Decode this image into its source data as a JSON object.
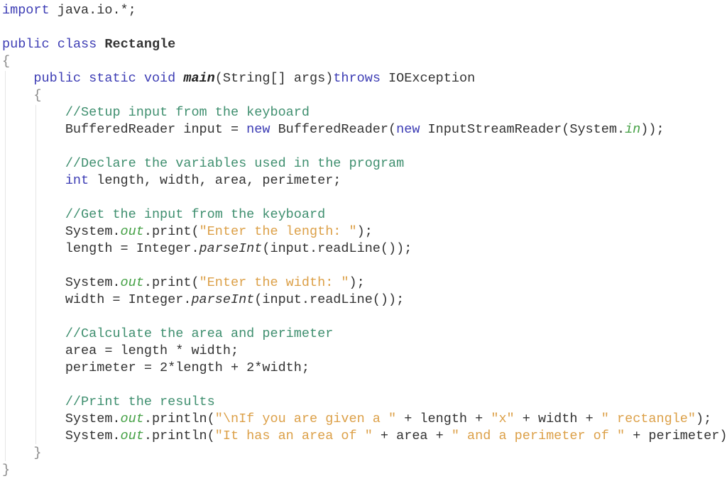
{
  "editor": {
    "language": "java",
    "colors": {
      "keyword": "#3c3cb4",
      "comment": "#3f8f6f",
      "string": "#dca048",
      "static_field": "#44a044",
      "text": "#333333"
    },
    "lines": [
      {
        "tokens": [
          {
            "t": "import",
            "k": "kw"
          },
          {
            "t": " java.io.*;",
            "k": "pl"
          }
        ]
      },
      {
        "tokens": []
      },
      {
        "tokens": [
          {
            "t": "public",
            "k": "kw"
          },
          {
            "t": " ",
            "k": "pl"
          },
          {
            "t": "class",
            "k": "kw"
          },
          {
            "t": " ",
            "k": "pl"
          },
          {
            "t": "Rectangle",
            "k": "cls"
          }
        ]
      },
      {
        "tokens": [
          {
            "t": "{",
            "k": "brace"
          }
        ]
      },
      {
        "tokens": [
          {
            "t": "    ",
            "k": "pl"
          },
          {
            "t": "public static void",
            "k": "kw"
          },
          {
            "t": " ",
            "k": "pl"
          },
          {
            "t": "main",
            "k": "mi"
          },
          {
            "t": "(String[] args)",
            "k": "pl"
          },
          {
            "t": "throws",
            "k": "kw"
          },
          {
            "t": " IOException",
            "k": "pl"
          }
        ]
      },
      {
        "tokens": [
          {
            "t": "    ",
            "k": "pl"
          },
          {
            "t": "{",
            "k": "brace"
          }
        ]
      },
      {
        "tokens": [
          {
            "t": "        ",
            "k": "pl"
          },
          {
            "t": "//Setup input from the keyboard",
            "k": "cm"
          }
        ]
      },
      {
        "tokens": [
          {
            "t": "        BufferedReader input = ",
            "k": "pl"
          },
          {
            "t": "new",
            "k": "kw"
          },
          {
            "t": " BufferedReader(",
            "k": "pl"
          },
          {
            "t": "new",
            "k": "kw"
          },
          {
            "t": " InputStreamReader(System.",
            "k": "pl"
          },
          {
            "t": "in",
            "k": "fld"
          },
          {
            "t": "));",
            "k": "pl"
          }
        ]
      },
      {
        "tokens": []
      },
      {
        "tokens": [
          {
            "t": "        ",
            "k": "pl"
          },
          {
            "t": "//Declare the variables used in the program",
            "k": "cm"
          }
        ]
      },
      {
        "tokens": [
          {
            "t": "        ",
            "k": "pl"
          },
          {
            "t": "int",
            "k": "kw"
          },
          {
            "t": " length, width, area, perimeter;",
            "k": "pl"
          }
        ]
      },
      {
        "tokens": []
      },
      {
        "tokens": [
          {
            "t": "        ",
            "k": "pl"
          },
          {
            "t": "//Get the input from the keyboard",
            "k": "cm"
          }
        ]
      },
      {
        "tokens": [
          {
            "t": "        System.",
            "k": "pl"
          },
          {
            "t": "out",
            "k": "fld"
          },
          {
            "t": ".print(",
            "k": "pl"
          },
          {
            "t": "\"Enter the length: \"",
            "k": "str"
          },
          {
            "t": ");",
            "k": "pl"
          }
        ]
      },
      {
        "tokens": [
          {
            "t": "        length = Integer.",
            "k": "pl"
          },
          {
            "t": "parseInt",
            "k": "it"
          },
          {
            "t": "(input.readLine());",
            "k": "pl"
          }
        ]
      },
      {
        "tokens": []
      },
      {
        "tokens": [
          {
            "t": "        System.",
            "k": "pl"
          },
          {
            "t": "out",
            "k": "fld"
          },
          {
            "t": ".print(",
            "k": "pl"
          },
          {
            "t": "\"Enter the width: \"",
            "k": "str"
          },
          {
            "t": ");",
            "k": "pl"
          }
        ]
      },
      {
        "tokens": [
          {
            "t": "        width = Integer.",
            "k": "pl"
          },
          {
            "t": "parseInt",
            "k": "it"
          },
          {
            "t": "(input.readLine());",
            "k": "pl"
          }
        ]
      },
      {
        "tokens": []
      },
      {
        "tokens": [
          {
            "t": "        ",
            "k": "pl"
          },
          {
            "t": "//Calculate the area and perimeter",
            "k": "cm"
          }
        ]
      },
      {
        "tokens": [
          {
            "t": "        area = length * width;",
            "k": "pl"
          }
        ]
      },
      {
        "tokens": [
          {
            "t": "        perimeter = 2*length + 2*width;",
            "k": "pl"
          }
        ]
      },
      {
        "tokens": []
      },
      {
        "tokens": [
          {
            "t": "        ",
            "k": "pl"
          },
          {
            "t": "//Print the results",
            "k": "cm"
          }
        ]
      },
      {
        "tokens": [
          {
            "t": "        System.",
            "k": "pl"
          },
          {
            "t": "out",
            "k": "fld"
          },
          {
            "t": ".println(",
            "k": "pl"
          },
          {
            "t": "\"\\nIf you are given a \"",
            "k": "str"
          },
          {
            "t": " + length + ",
            "k": "pl"
          },
          {
            "t": "\"x\"",
            "k": "str"
          },
          {
            "t": " + width + ",
            "k": "pl"
          },
          {
            "t": "\" rectangle\"",
            "k": "str"
          },
          {
            "t": ");",
            "k": "pl"
          }
        ]
      },
      {
        "tokens": [
          {
            "t": "        System.",
            "k": "pl"
          },
          {
            "t": "out",
            "k": "fld"
          },
          {
            "t": ".println(",
            "k": "pl"
          },
          {
            "t": "\"It has an area of \"",
            "k": "str"
          },
          {
            "t": " + area + ",
            "k": "pl"
          },
          {
            "t": "\" and a perimeter of \"",
            "k": "str"
          },
          {
            "t": " + perimeter);",
            "k": "pl"
          }
        ]
      },
      {
        "tokens": [
          {
            "t": "    ",
            "k": "pl"
          },
          {
            "t": "}",
            "k": "brace"
          }
        ]
      },
      {
        "tokens": [
          {
            "t": "}",
            "k": "brace"
          }
        ]
      }
    ]
  }
}
